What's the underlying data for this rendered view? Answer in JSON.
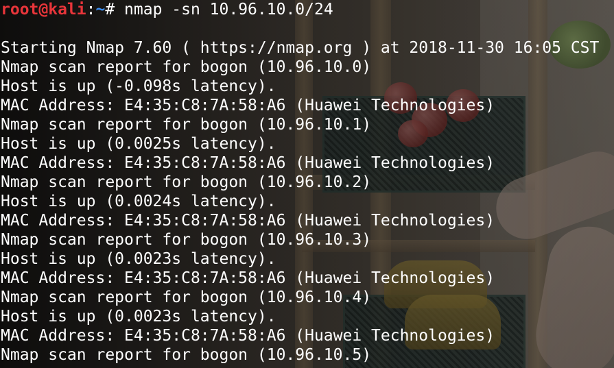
{
  "terminal": {
    "prompt": {
      "user_host": "root@kali",
      "separator": ":",
      "path": "~",
      "symbol": "# ",
      "command": "nmap -sn 10.96.10.0/24"
    },
    "output_lines": [
      "Starting Nmap 7.60 ( https://nmap.org ) at 2018-11-30 16:05 CST",
      "Nmap scan report for bogon (10.96.10.0)",
      "Host is up (-0.098s latency).",
      "MAC Address: E4:35:C8:7A:58:A6 (Huawei Technologies)",
      "Nmap scan report for bogon (10.96.10.1)",
      "Host is up (0.0025s latency).",
      "MAC Address: E4:35:C8:7A:58:A6 (Huawei Technologies)",
      "Nmap scan report for bogon (10.96.10.2)",
      "Host is up (0.0024s latency).",
      "MAC Address: E4:35:C8:7A:58:A6 (Huawei Technologies)",
      "Nmap scan report for bogon (10.96.10.3)",
      "Host is up (0.0023s latency).",
      "MAC Address: E4:35:C8:7A:58:A6 (Huawei Technologies)",
      "Nmap scan report for bogon (10.96.10.4)",
      "Host is up (0.0023s latency).",
      "MAC Address: E4:35:C8:7A:58:A6 (Huawei Technologies)",
      "Nmap scan report for bogon (10.96.10.5)"
    ]
  },
  "colors": {
    "prompt_user": "#e8353a",
    "prompt_path": "#3b8df0",
    "text": "#ffffff"
  }
}
